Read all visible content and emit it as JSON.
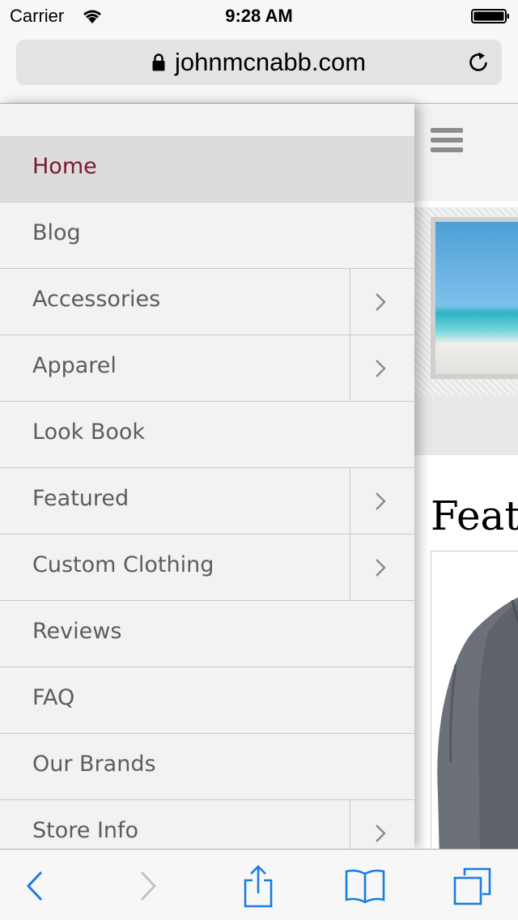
{
  "status_bar": {
    "carrier": "Carrier",
    "time": "9:28 AM",
    "icons": [
      "wifi-icon",
      "battery-icon"
    ]
  },
  "browser": {
    "url": "johnmcnabb.com",
    "icons": [
      "lock-icon",
      "reload-icon"
    ]
  },
  "menu": {
    "items": [
      {
        "label": "Home",
        "active": true,
        "has_submenu": false
      },
      {
        "label": "Blog",
        "active": false,
        "has_submenu": false
      },
      {
        "label": "Accessories",
        "active": false,
        "has_submenu": true
      },
      {
        "label": "Apparel",
        "active": false,
        "has_submenu": true
      },
      {
        "label": "Look Book",
        "active": false,
        "has_submenu": false
      },
      {
        "label": "Featured",
        "active": false,
        "has_submenu": true
      },
      {
        "label": "Custom Clothing",
        "active": false,
        "has_submenu": true
      },
      {
        "label": "Reviews",
        "active": false,
        "has_submenu": false
      },
      {
        "label": "FAQ",
        "active": false,
        "has_submenu": false
      },
      {
        "label": "Our Brands",
        "active": false,
        "has_submenu": false
      },
      {
        "label": "Store Info",
        "active": false,
        "has_submenu": true
      }
    ]
  },
  "page": {
    "heading": "Featu"
  },
  "toolbar": {
    "icons": [
      "back-icon",
      "forward-icon",
      "share-icon",
      "bookmarks-icon",
      "tabs-icon"
    ]
  },
  "colors": {
    "active_menu_text": "#7b1a2a",
    "menu_text": "#5c5c5c",
    "ios_blue": "#1a7de0",
    "disabled_gray": "#c4c4c4"
  }
}
